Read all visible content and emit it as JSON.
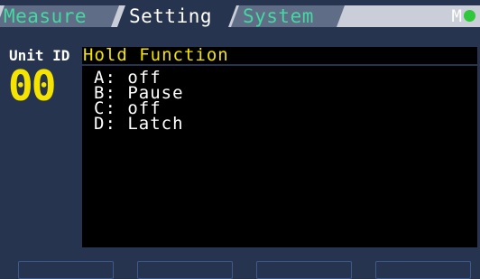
{
  "tabs": [
    {
      "label": "Measure",
      "active": false
    },
    {
      "label": "Setting",
      "active": true
    },
    {
      "label": "System",
      "active": false
    }
  ],
  "status": {
    "mode": "M",
    "indicator_color": "#2ec83a"
  },
  "unit": {
    "label": "Unit ID",
    "value": "00"
  },
  "panel": {
    "title": "Hold Function",
    "items": [
      {
        "key": "A:",
        "value": "off"
      },
      {
        "key": "B:",
        "value": "Pause"
      },
      {
        "key": "C:",
        "value": "off"
      },
      {
        "key": "D:",
        "value": "Latch"
      }
    ]
  },
  "softkeys": [
    "",
    "",
    "",
    ""
  ],
  "colors": {
    "background": "#27344f",
    "accent_yellow": "#f4e400",
    "inactive_tab_text": "#44d8a2"
  }
}
